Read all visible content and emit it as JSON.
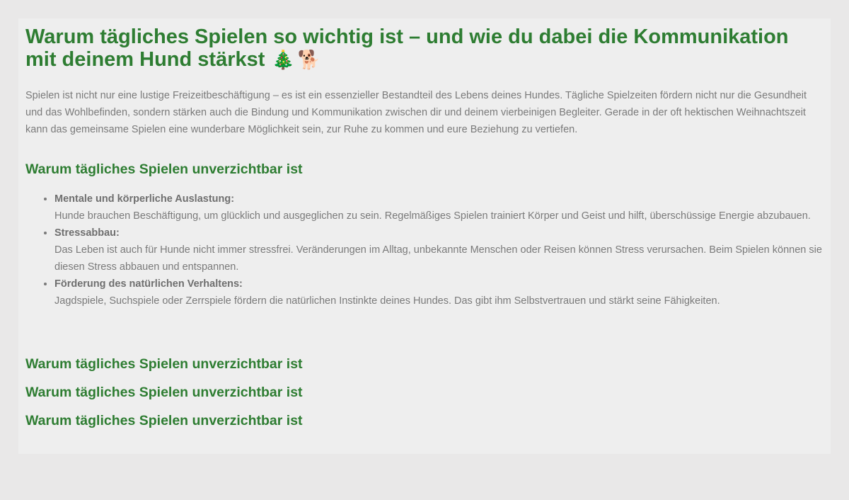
{
  "article": {
    "title": "Warum tägliches Spielen so wichtig ist – und wie du dabei die Kommunikation mit deinem Hund stärkst",
    "title_emoji_tree": "🎄",
    "title_emoji_dog": "🐕",
    "intro": "Spielen ist nicht nur eine lustige Freizeitbeschäftigung – es ist ein essenzieller Bestandteil des Lebens deines Hundes. Tägliche Spielzeiten fördern nicht nur die Gesundheit und das Wohlbefinden, sondern stärken auch die Bindung und Kommunikation zwischen dir und deinem vierbeinigen Begleiter. Gerade in der oft hektischen Weihnachtszeit kann das gemeinsame Spielen eine wunderbare Möglichkeit sein, zur Ruhe zu kommen und eure Beziehung zu vertiefen.",
    "section_heading": "Warum tägliches Spielen unverzichtbar ist",
    "items": [
      {
        "title": "Mentale und körperliche Auslastung:",
        "text": "Hunde brauchen Beschäftigung, um glücklich und ausgeglichen zu sein. Regelmäßiges Spielen trainiert Körper und Geist und hilft, überschüssige Energie abzubauen."
      },
      {
        "title": "Stressabbau:",
        "text": "Das Leben ist auch für Hunde nicht immer stressfrei. Veränderungen im Alltag, unbekannte Menschen oder Reisen können Stress verursachen. Beim Spielen können sie diesen Stress abbauen und entspannen."
      },
      {
        "title": "Förderung des natürlichen Verhaltens:",
        "text": "Jagdspiele, Suchspiele oder Zerrspiele fördern die natürlichen Instinkte deines Hundes. Das gibt ihm Selbstvertrauen und stärkt seine Fähigkeiten."
      }
    ],
    "extra_headings": [
      "Warum tägliches Spielen unverzichtbar ist",
      "Warum tägliches Spielen unverzichtbar ist",
      "Warum tägliches Spielen unverzichtbar ist"
    ]
  },
  "colors": {
    "heading": "#2e7d32",
    "body_text": "#7a7a7a",
    "card_background": "#eeeeee",
    "page_background": "#e9e8e8"
  }
}
